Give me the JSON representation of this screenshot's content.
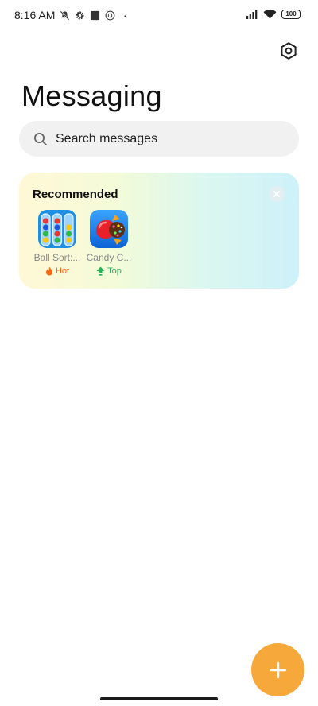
{
  "status_bar": {
    "time": "8:16 AM",
    "battery": "100",
    "icons": [
      "notification-off-icon",
      "gear-icon",
      "square-icon",
      "sim-icon",
      "dot-icon",
      "signal-icon",
      "wifi-icon",
      "battery-icon"
    ]
  },
  "header": {
    "title": "Messaging",
    "settings_icon": "settings-hexagon-icon"
  },
  "search": {
    "placeholder": "Search messages"
  },
  "recommended": {
    "title": "Recommended",
    "apps": [
      {
        "name": "Ball Sort:...",
        "badge": "Hot",
        "badge_color": "#f06a14",
        "icon": "ball-sort-icon"
      },
      {
        "name": "Candy C...",
        "badge": "Top",
        "badge_color": "#21b55b",
        "icon": "candy-crush-icon"
      }
    ]
  },
  "fab": {
    "icon": "plus-icon",
    "color": "#f6a83a"
  }
}
